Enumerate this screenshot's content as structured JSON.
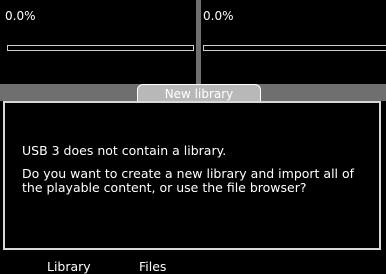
{
  "decks": [
    {
      "percent_label": "0.0%",
      "progress": 0.0
    },
    {
      "percent_label": "0.0%",
      "progress": 0.0
    }
  ],
  "dialog": {
    "title": "New library",
    "message_line1": "USB 3 does not contain a library.",
    "message_line2": "Do you want to create a new library and import all of the playable content, or use the file browser?"
  },
  "buttons": {
    "library_label": "Library",
    "files_label": "Files"
  },
  "colors": {
    "background": "#000000",
    "panel_gray": "#6f6f6f",
    "tab_gray": "#b8b8b8",
    "text": "#ffffff"
  }
}
